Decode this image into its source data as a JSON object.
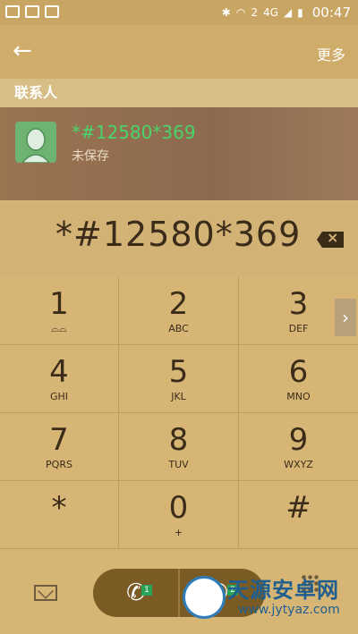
{
  "status_bar": {
    "time": "00:47",
    "network": "4G",
    "sim_indicator": "2"
  },
  "app_bar": {
    "more_label": "更多"
  },
  "contacts_section": {
    "label": "联系人"
  },
  "contact": {
    "number": "*#12580*369",
    "status": "未保存"
  },
  "dialed_number": "*#12580*369",
  "keypad": [
    {
      "digit": "1",
      "letters": ""
    },
    {
      "digit": "2",
      "letters": "ABC"
    },
    {
      "digit": "3",
      "letters": "DEF"
    },
    {
      "digit": "4",
      "letters": "GHI"
    },
    {
      "digit": "5",
      "letters": "JKL"
    },
    {
      "digit": "6",
      "letters": "MNO"
    },
    {
      "digit": "7",
      "letters": "PQRS"
    },
    {
      "digit": "8",
      "letters": "TUV"
    },
    {
      "digit": "9",
      "letters": "WXYZ"
    },
    {
      "digit": "*",
      "letters": ""
    },
    {
      "digit": "0",
      "letters": "+"
    },
    {
      "digit": "#",
      "letters": ""
    }
  ],
  "call_buttons": {
    "sim1": "1",
    "sim2": "2"
  },
  "watermark": {
    "cn": "天源安卓网",
    "en": "www.jytyaz.com"
  },
  "icons": {
    "back": "arrow-left-icon",
    "voicemail": "voicemail-icon",
    "backspace": "backspace-icon",
    "message": "message-icon",
    "call": "phone-icon",
    "keypad_toggle": "keypad-grid-icon"
  }
}
